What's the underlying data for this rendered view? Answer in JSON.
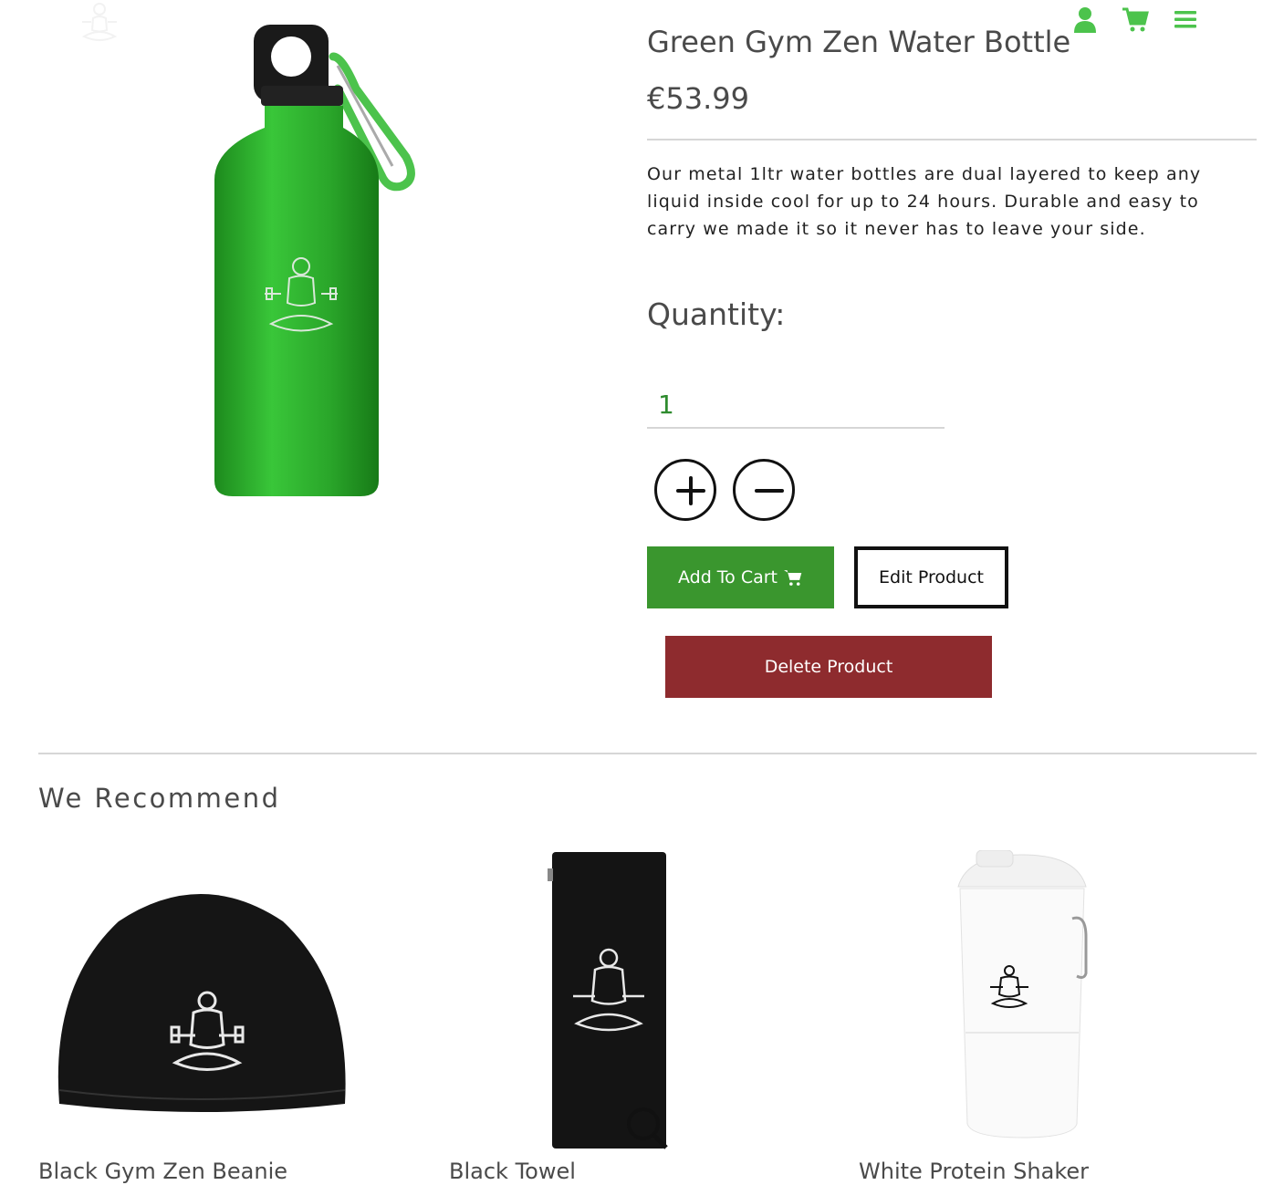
{
  "header": {
    "icons": [
      "user-icon",
      "shopping-cart-icon",
      "hamburger-menu-icon"
    ],
    "accent_color": "#4cc34c"
  },
  "product": {
    "title": "Green Gym Zen Water Bottle",
    "price": "€53.99",
    "description": "Our metal 1ltr water bottles are dual layered to keep any liquid inside cool for up to 24 hours. Durable and easy to carry we made it so it never has to leave your side.",
    "color": "#2fa82f"
  },
  "quantity": {
    "label": "Quantity:",
    "value": "1"
  },
  "actions": {
    "add_to_cart": "Add To Cart",
    "edit": "Edit Product",
    "delete": "Delete Product",
    "add_color": "#3a962e",
    "delete_color": "#8e2b2e"
  },
  "recommend": {
    "title": "We Recommend",
    "items": [
      {
        "name": "Black Gym Zen Beanie"
      },
      {
        "name": "Black Towel"
      },
      {
        "name": "White Protein Shaker"
      }
    ]
  }
}
